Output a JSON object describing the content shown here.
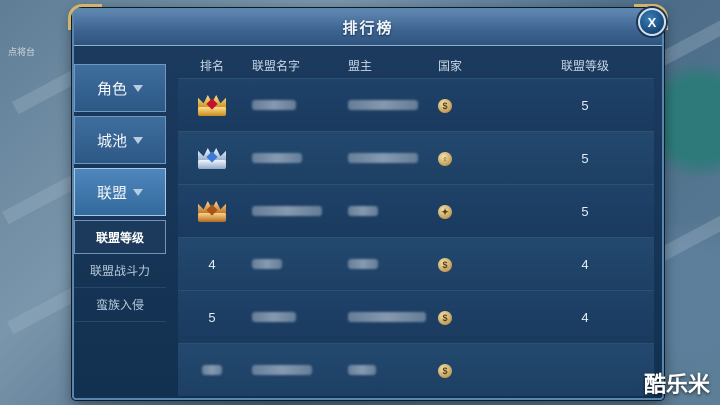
{
  "map": {
    "label": "点将台"
  },
  "window": {
    "title": "排行榜",
    "close_label": "X"
  },
  "sidebar": {
    "tabs": [
      {
        "label": "角色"
      },
      {
        "label": "城池"
      },
      {
        "label": "联盟",
        "active": true
      }
    ],
    "sub_items": [
      {
        "label": "联盟等级",
        "active": true
      },
      {
        "label": "联盟战斗力"
      },
      {
        "label": "蛮族入侵"
      }
    ]
  },
  "table": {
    "headers": [
      "排名",
      "联盟名字",
      "盟主",
      "国家",
      "联盟等级"
    ],
    "rows": [
      {
        "rank": "",
        "rank_icon": "gold-crown-icon",
        "level": "5",
        "nation_icon": "nation-emblem-icon"
      },
      {
        "rank": "",
        "rank_icon": "silver-crown-icon",
        "level": "5",
        "nation_icon": "nation-emblem-icon"
      },
      {
        "rank": "",
        "rank_icon": "bronze-crown-icon",
        "level": "5",
        "nation_icon": "nation-emblem-icon"
      },
      {
        "rank": "4",
        "level": "4",
        "nation_icon": "nation-emblem-icon"
      },
      {
        "rank": "5",
        "level": "4",
        "nation_icon": "nation-emblem-icon"
      },
      {
        "rank": "",
        "level": "",
        "nation_icon": "nation-emblem-icon"
      }
    ]
  },
  "watermark": "酷乐米"
}
